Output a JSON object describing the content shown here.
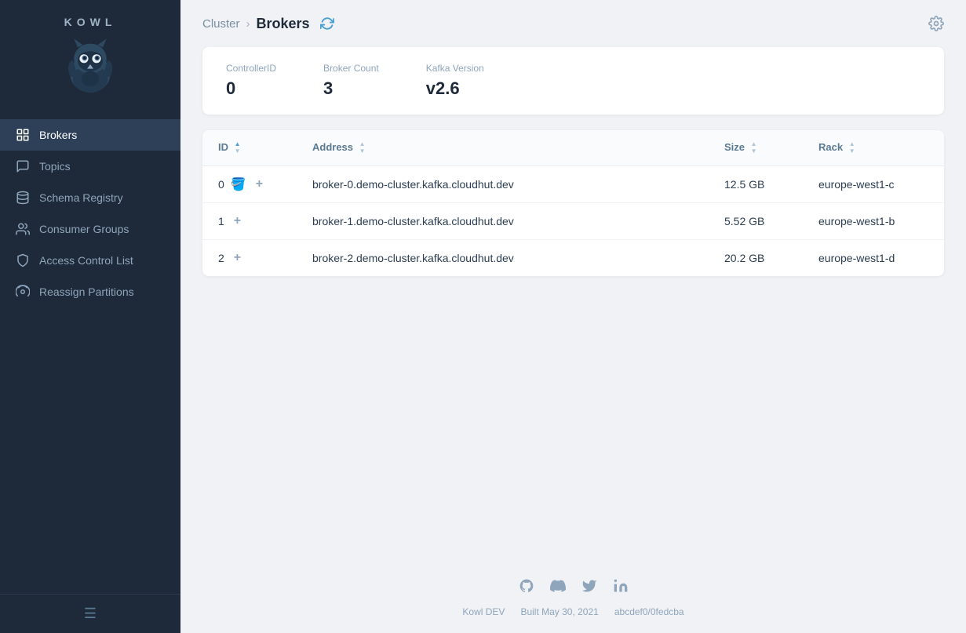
{
  "sidebar": {
    "logo_text": "KOWL",
    "nav_items": [
      {
        "id": "brokers",
        "label": "Brokers",
        "active": true
      },
      {
        "id": "topics",
        "label": "Topics",
        "active": false
      },
      {
        "id": "schema-registry",
        "label": "Schema Registry",
        "active": false
      },
      {
        "id": "consumer-groups",
        "label": "Consumer Groups",
        "active": false
      },
      {
        "id": "access-control-list",
        "label": "Access Control List",
        "active": false
      },
      {
        "id": "reassign-partitions",
        "label": "Reassign Partitions",
        "active": false
      }
    ]
  },
  "header": {
    "breadcrumb_parent": "Cluster",
    "breadcrumb_current": "Brokers",
    "settings_tooltip": "Settings"
  },
  "stats": {
    "controller_id_label": "ControllerID",
    "controller_id_value": "0",
    "broker_count_label": "Broker Count",
    "broker_count_value": "3",
    "kafka_version_label": "Kafka Version",
    "kafka_version_value": "v2.6"
  },
  "table": {
    "columns": [
      {
        "key": "id",
        "label": "ID",
        "sorted": true,
        "sort_dir": "asc"
      },
      {
        "key": "address",
        "label": "Address",
        "sorted": false
      },
      {
        "key": "size",
        "label": "Size",
        "sorted": false
      },
      {
        "key": "rack",
        "label": "Rack",
        "sorted": false
      }
    ],
    "rows": [
      {
        "id": "0",
        "address": "broker-0.demo-cluster.kafka.cloudhut.dev",
        "size": "12.5 GB",
        "rack": "europe-west1-c"
      },
      {
        "id": "1",
        "address": "broker-1.demo-cluster.kafka.cloudhut.dev",
        "size": "5.52 GB",
        "rack": "europe-west1-b"
      },
      {
        "id": "2",
        "address": "broker-2.demo-cluster.kafka.cloudhut.dev",
        "size": "20.2 GB",
        "rack": "europe-west1-d"
      }
    ]
  },
  "footer": {
    "app_name": "Kowl DEV",
    "build_info": "Built May 30, 2021",
    "commit": "abcdef0/0fedcba",
    "icons": [
      "github",
      "discord",
      "twitter",
      "linkedin"
    ]
  }
}
